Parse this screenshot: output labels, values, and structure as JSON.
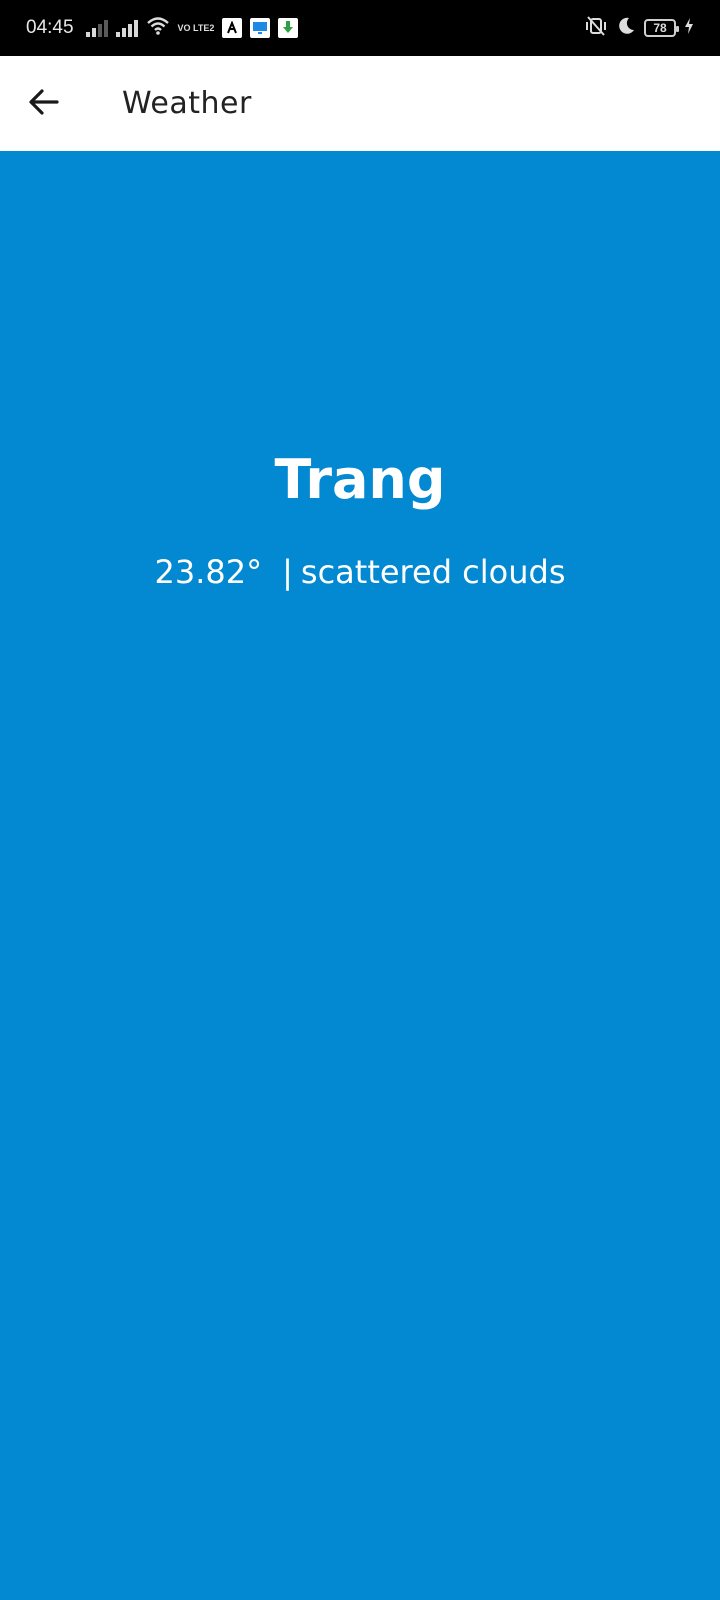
{
  "status_bar": {
    "time": "04:45",
    "volte_label": "VO LTE2",
    "battery": "78",
    "icons": [
      "signal-icon",
      "signal-icon",
      "wifi-icon",
      "volte-icon",
      "app-notification-icon",
      "monitor-notification-icon",
      "download-notification-icon",
      "vibrate-off-icon",
      "moon-icon",
      "battery-icon",
      "charging-icon"
    ]
  },
  "app_bar": {
    "back_icon": "arrow-left-icon",
    "title": "Weather"
  },
  "weather": {
    "city": "Trang",
    "temperature": "23.82°",
    "separator": "|",
    "description": "scattered clouds"
  },
  "colors": {
    "background": "#0388d2",
    "app_bar": "#ffffff",
    "status_bar": "#000000",
    "text_on_blue": "#ffffff"
  }
}
